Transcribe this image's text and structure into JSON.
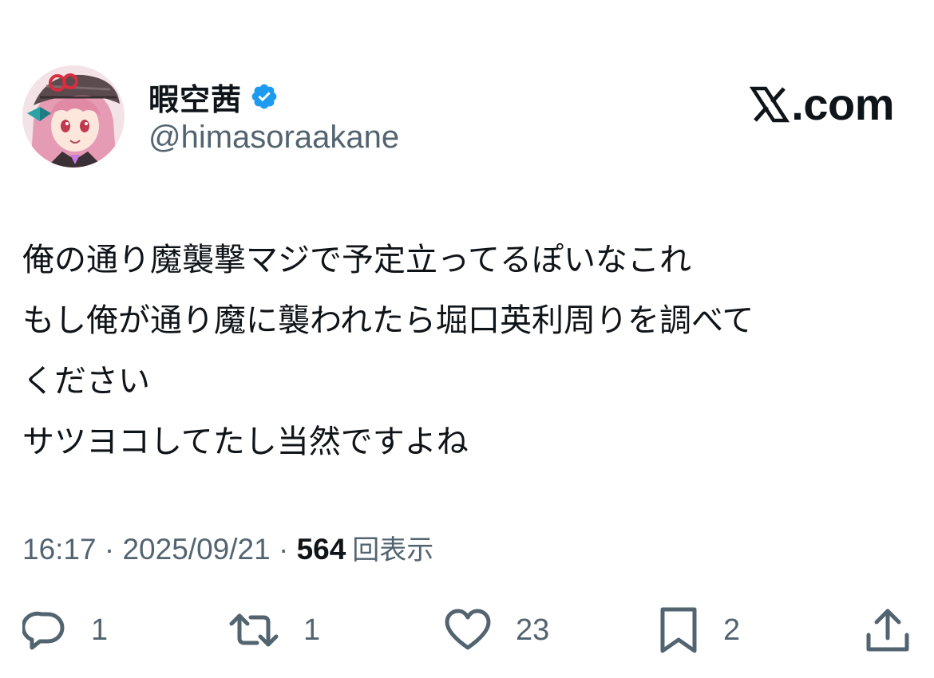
{
  "header": {
    "display_name": "暇空茜",
    "handle": "@himasoraakane",
    "brand": ".com",
    "verified_color": "#1d9bf0"
  },
  "tweet": {
    "lines": [
      "俺の通り魔襲撃マジで予定立ってるぽいなこれ",
      "もし俺が通り魔に襲われたら堀口英利周りを調べて",
      "ください",
      "サツヨコしてたし当然ですよね"
    ]
  },
  "meta": {
    "time": "16:17",
    "separator": "·",
    "date": "2025/09/21",
    "views_count": "564",
    "views_label": "回表示"
  },
  "actions": {
    "reply": {
      "icon": "reply-icon",
      "count": "1"
    },
    "retweet": {
      "icon": "retweet-icon",
      "count": "1"
    },
    "like": {
      "icon": "heart-icon",
      "count": "23"
    },
    "bookmark": {
      "icon": "bookmark-icon",
      "count": "2"
    },
    "share": {
      "icon": "share-icon"
    }
  },
  "colors": {
    "text": "#0f1419",
    "secondary": "#536471",
    "accent": "#1d9bf0"
  }
}
